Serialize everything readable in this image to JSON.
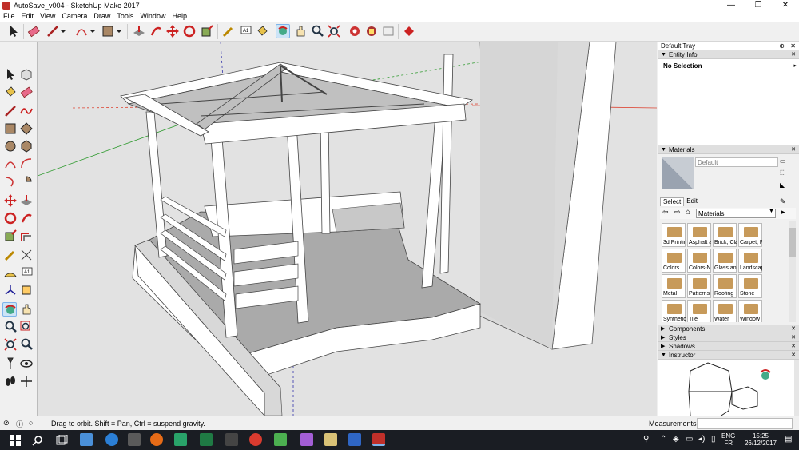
{
  "window": {
    "title": "AutoSave_v004 - SketchUp Make 2017",
    "min": "—",
    "max": "❐",
    "close": "✕"
  },
  "menu": [
    "File",
    "Edit",
    "View",
    "Camera",
    "Draw",
    "Tools",
    "Window",
    "Help"
  ],
  "tray": {
    "title": "Default Tray",
    "entity_info": {
      "label": "Entity Info",
      "selection": "No Selection"
    },
    "materials": {
      "label": "Materials",
      "current": "Default",
      "tabs": [
        "Select",
        "Edit"
      ],
      "collection": "Materials",
      "items": [
        "3d Printir",
        "Asphalt a",
        "Brick, Cla",
        "Carpet, F",
        "Colors",
        "Colors-N",
        "Glass anx",
        "Landscap",
        "Metal",
        "Patterns",
        "Roofing",
        "Stone",
        "Synthetic",
        "Tile",
        "Water",
        "Window"
      ]
    },
    "components": "Components",
    "styles": "Styles",
    "shadows": "Shadows",
    "instructor": "Instructor"
  },
  "status": {
    "message": "Drag to orbit. Shift = Pan, Ctrl = suspend gravity.",
    "measurements_label": "Measurements"
  },
  "taskbar": {
    "lang1": "ENG",
    "lang2": "FR",
    "time": "15:25",
    "date": "26/12/2017"
  },
  "colors": {
    "accent": "#c0302a",
    "selection": "#cce4f7",
    "taskbar": "#1a1d23",
    "model_face": "#ffffff",
    "model_shadow": "#9f9f9f"
  }
}
